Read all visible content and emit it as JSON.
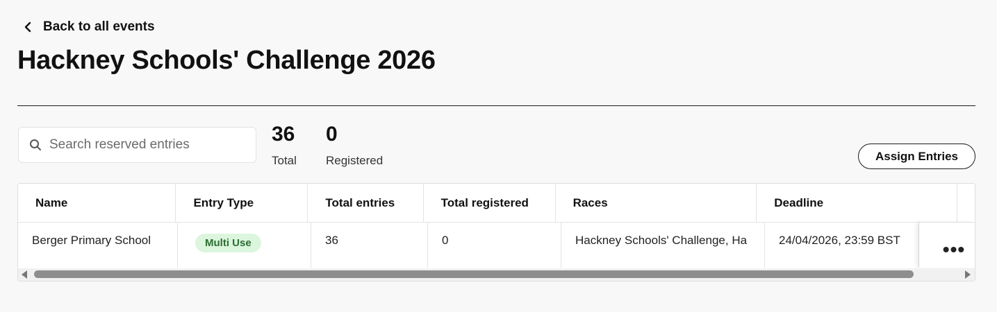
{
  "nav": {
    "back_label": "Back to all events"
  },
  "page": {
    "title": "Hackney Schools' Challenge 2026"
  },
  "search": {
    "placeholder": "Search reserved entries",
    "value": ""
  },
  "stats": {
    "total": {
      "value": "36",
      "label": "Total"
    },
    "registered": {
      "value": "0",
      "label": "Registered"
    }
  },
  "actions": {
    "assign_label": "Assign Entries"
  },
  "table": {
    "columns": [
      "Name",
      "Entry Type",
      "Total entries",
      "Total registered",
      "Races",
      "Deadline"
    ],
    "rows": [
      {
        "name": "Berger Primary School",
        "entry_type": "Multi Use",
        "total_entries": "36",
        "total_registered": "0",
        "races": "Hackney Schools' Challenge, Ha",
        "deadline": "24/04/2026, 23:59 BST",
        "actions_icon": "more-horizontal-icon"
      }
    ]
  },
  "colors": {
    "badge_bg": "#dcf5dd",
    "badge_text": "#2b6e32",
    "background": "#f8f8f8"
  }
}
